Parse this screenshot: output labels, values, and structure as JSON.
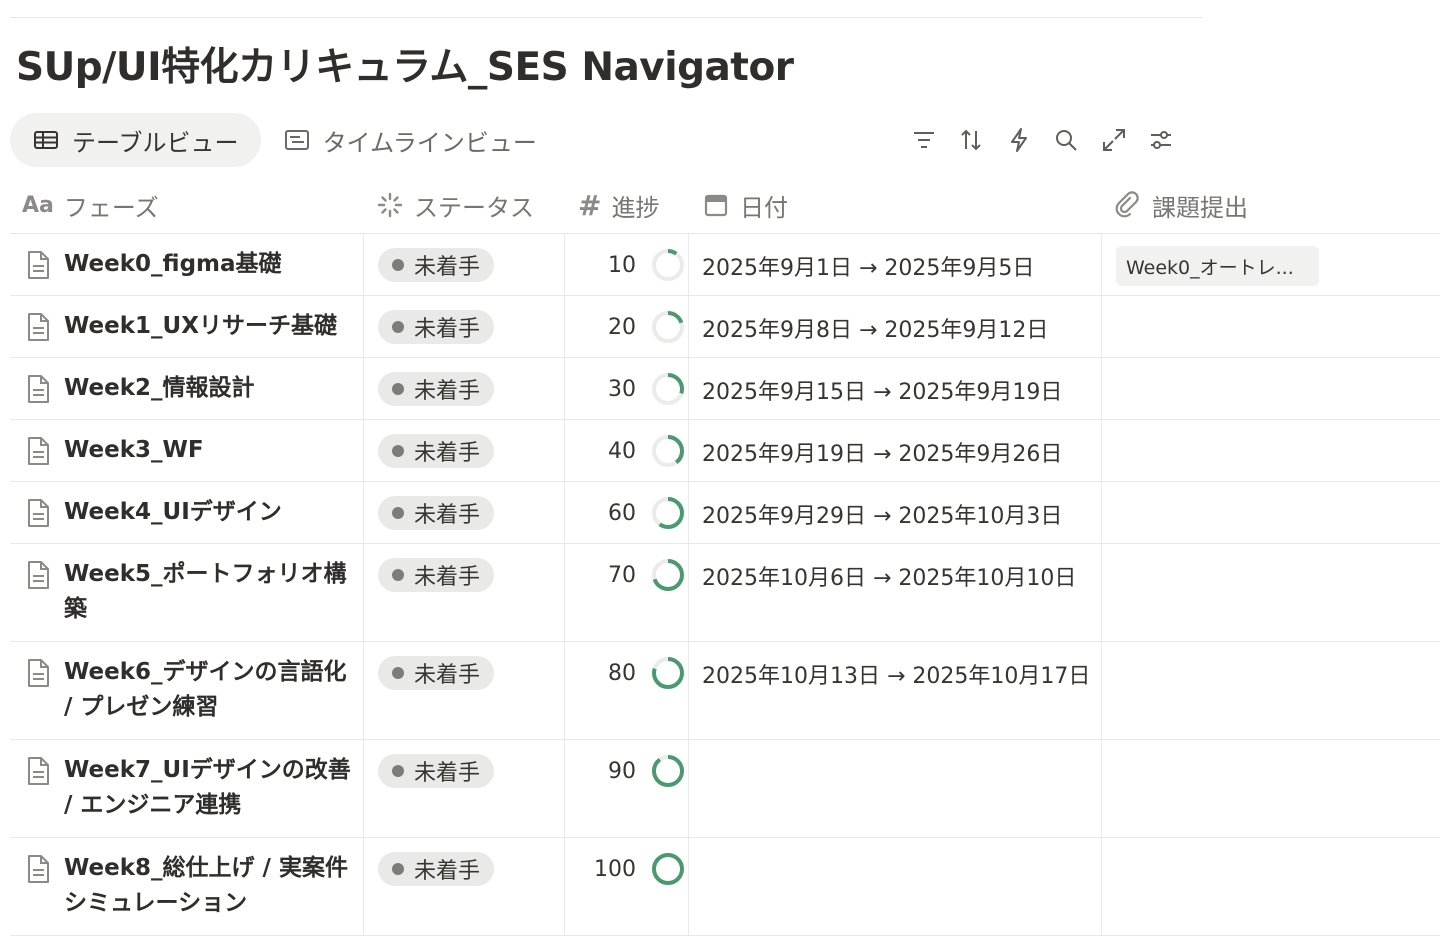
{
  "page": {
    "title": "SUp/UI特化カリキュラム_SES Navigator"
  },
  "views": [
    {
      "label": "テーブルビュー",
      "icon": "table-icon",
      "active": true
    },
    {
      "label": "タイムラインビュー",
      "icon": "timeline-icon",
      "active": false
    }
  ],
  "toolbar": [
    "filter-icon",
    "sort-icon",
    "automation-bolt-icon",
    "search-icon",
    "expand-icon",
    "settings-sliders-icon"
  ],
  "columns": {
    "phase": {
      "label": "フェーズ",
      "icon_text": "Aa"
    },
    "status": {
      "label": "ステータス"
    },
    "progress": {
      "label": "進捗",
      "icon_text": "#"
    },
    "date": {
      "label": "日付"
    },
    "submission": {
      "label": "課題提出"
    }
  },
  "rows": [
    {
      "name_bold": "Week0_figma基礎",
      "name_rest": "",
      "status": "未着手",
      "progress": 10,
      "date": "2025年9月1日 → 2025年9月5日",
      "file": "Week0_オートレ..."
    },
    {
      "name_bold": "Week1_UXリサーチ基礎",
      "name_rest": "",
      "status": "未着手",
      "progress": 20,
      "date": "2025年9月8日 → 2025年9月12日",
      "file": ""
    },
    {
      "name_bold": "Week2_情報設計",
      "name_rest": "",
      "status": "未着手",
      "progress": 30,
      "date": "2025年9月15日 → 2025年9月19日",
      "file": ""
    },
    {
      "name_bold": "Week3_WF",
      "name_rest": "",
      "status": "未着手",
      "progress": 40,
      "date": "2025年9月19日 → 2025年9月26日",
      "file": ""
    },
    {
      "name_bold": "Week4_UIデザイン",
      "name_rest": "",
      "status": "未着手",
      "progress": 60,
      "date": "2025年9月29日 → 2025年10月3日",
      "file": ""
    },
    {
      "name_bold": "Week5_ポートフォリオ構築",
      "name_rest": "",
      "status": "未着手",
      "progress": 70,
      "date": "2025年10月6日 → 2025年10月10日",
      "file": ""
    },
    {
      "name_bold": "Week6_デザインの言語化 / プレゼン練習",
      "name_rest": "",
      "status": "未着手",
      "progress": 80,
      "date": "2025年10月13日 → 2025年10月17日",
      "file": ""
    },
    {
      "name_bold": "Week7_UIデザインの改善 / エンジニア連携",
      "name_rest": "",
      "status": "未着手",
      "progress": 90,
      "date": "",
      "file": ""
    },
    {
      "name_bold": "Week8_総仕上げ / 実案件シミュレーション",
      "name_rest": "",
      "status": "未着手",
      "progress": 100,
      "date": "",
      "file": ""
    }
  ],
  "colors": {
    "progress_ring": "#4a9a6e",
    "ring_track": "#ebebea",
    "pill_bg": "#e9e9e7",
    "dot": "#7d7c78"
  }
}
